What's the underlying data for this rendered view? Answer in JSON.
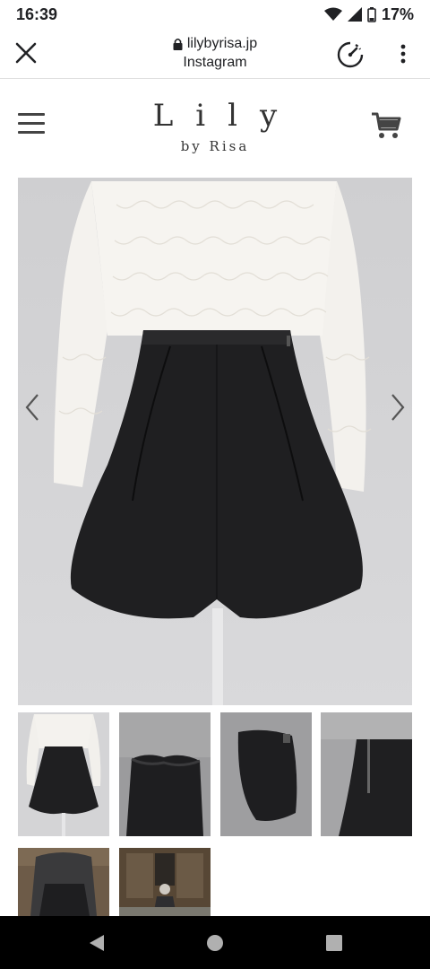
{
  "status": {
    "time": "16:39",
    "battery": "17%"
  },
  "browser": {
    "url": "lilybyrisa.jp",
    "subtitle": "Instagram"
  },
  "site": {
    "logo_main": "Lily",
    "logo_sub": "by Risa"
  },
  "icons": {
    "close": "close-icon",
    "lock": "lock-icon",
    "speed": "speedometer-icon",
    "more": "more-vert-icon",
    "menu": "menu-icon",
    "cart": "cart-icon",
    "prev": "chevron-left-icon",
    "next": "chevron-right-icon"
  },
  "colors": {
    "background": "#ffffff",
    "image_bg": "#d3d3d5",
    "nav_bar": "#000000"
  }
}
